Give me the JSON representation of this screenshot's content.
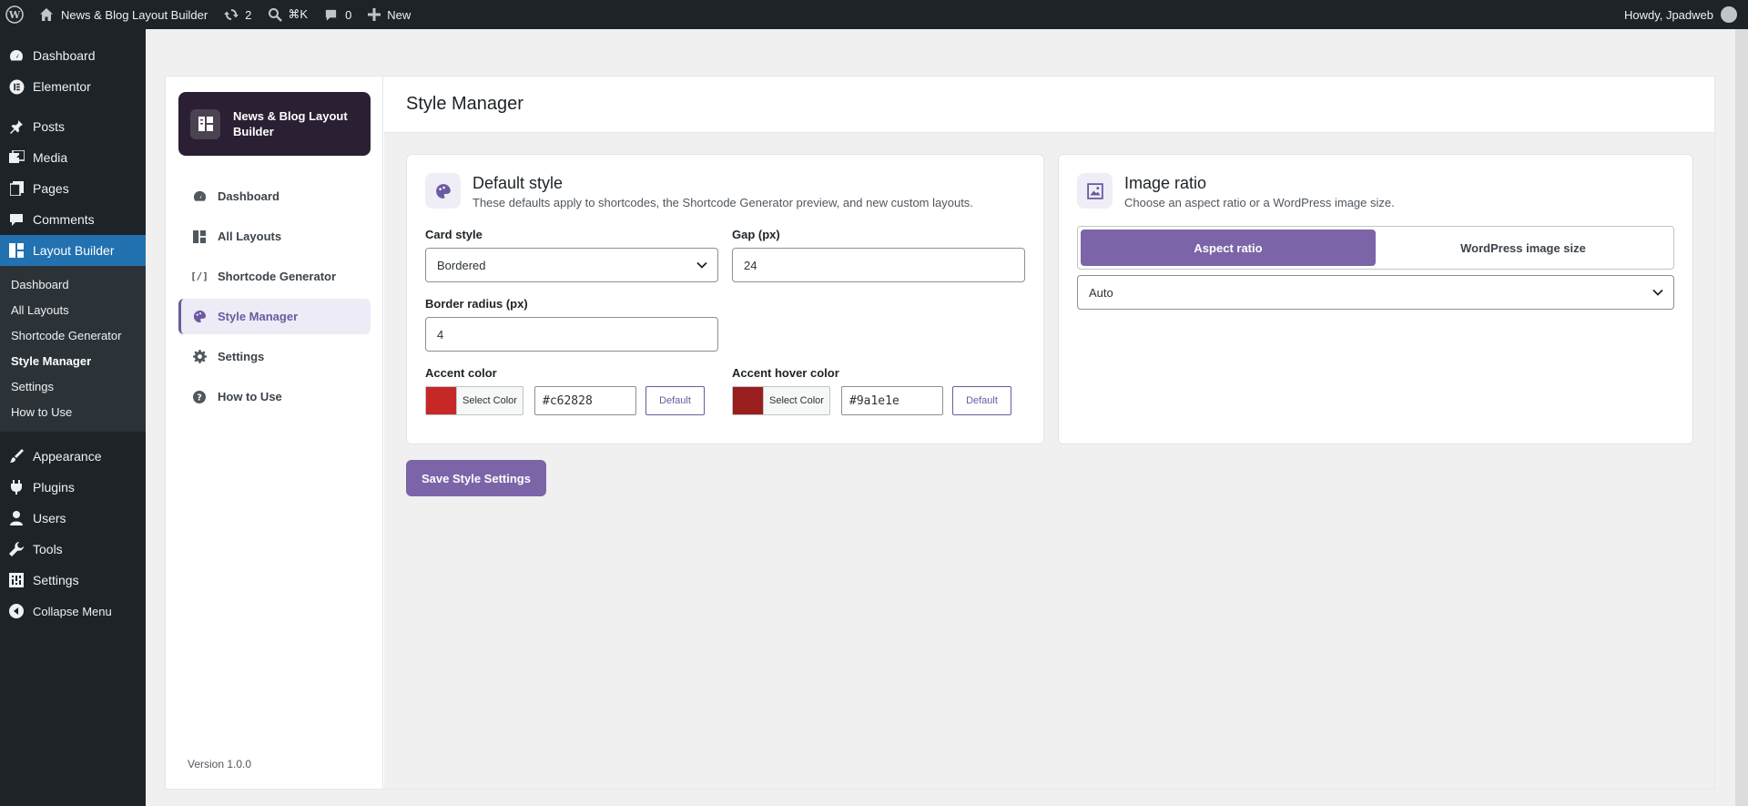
{
  "adminbar": {
    "site_name": "News & Blog Layout Builder",
    "updates_count": "2",
    "search_shortcut": "⌘K",
    "comments_count": "0",
    "new_label": "New",
    "howdy": "Howdy, Jpadweb"
  },
  "adminmenu": {
    "items": [
      {
        "label": "Dashboard",
        "icon": "dashboard-icon"
      },
      {
        "label": "Elementor",
        "icon": "elementor-icon"
      },
      {
        "label": "Posts",
        "icon": "pin-icon"
      },
      {
        "label": "Media",
        "icon": "media-icon"
      },
      {
        "label": "Pages",
        "icon": "pages-icon"
      },
      {
        "label": "Comments",
        "icon": "comment-icon"
      },
      {
        "label": "Layout Builder",
        "icon": "layout-icon"
      },
      {
        "label": "Appearance",
        "icon": "brush-icon"
      },
      {
        "label": "Plugins",
        "icon": "plugin-icon"
      },
      {
        "label": "Users",
        "icon": "user-icon"
      },
      {
        "label": "Tools",
        "icon": "wrench-icon"
      },
      {
        "label": "Settings",
        "icon": "settings-icon"
      },
      {
        "label": "Collapse Menu",
        "icon": "collapse-icon"
      }
    ],
    "submenu": [
      "Dashboard",
      "All Layouts",
      "Shortcode Generator",
      "Style Manager",
      "Settings",
      "How to Use"
    ]
  },
  "plugin": {
    "brand_title": "News & Blog Layout Builder",
    "nav": [
      {
        "label": "Dashboard",
        "icon": "dashboard-icon"
      },
      {
        "label": "All Layouts",
        "icon": "grid-icon"
      },
      {
        "label": "Shortcode Generator",
        "icon": "shortcode-icon"
      },
      {
        "label": "Style Manager",
        "icon": "palette-icon"
      },
      {
        "label": "Settings",
        "icon": "gear-icon"
      },
      {
        "label": "How to Use",
        "icon": "help-icon"
      }
    ],
    "shortcode_glyph": "[/]",
    "version": "Version 1.0.0"
  },
  "main": {
    "page_title": "Style Manager",
    "default_style": {
      "title": "Default style",
      "description": "These defaults apply to shortcodes, the Shortcode Generator preview, and new custom layouts.",
      "card_style_label": "Card style",
      "card_style_value": "Bordered",
      "gap_label": "Gap (px)",
      "gap_value": "24",
      "border_radius_label": "Border radius (px)",
      "border_radius_value": "4",
      "accent_label": "Accent color",
      "accent_value": "#c62828",
      "accent_hover_label": "Accent hover color",
      "accent_hover_value": "#9a1e1e",
      "select_color_label": "Select Color",
      "default_label": "Default"
    },
    "image_ratio": {
      "title": "Image ratio",
      "description": "Choose an aspect ratio or a WordPress image size.",
      "tab_aspect": "Aspect ratio",
      "tab_wp_size": "WordPress image size",
      "ratio_value": "Auto"
    },
    "save_label": "Save Style Settings"
  },
  "colors": {
    "accent": "#c62828",
    "accent_hover": "#9a1e1e",
    "brand_purple": "#7b65a8",
    "wp_blue": "#2271b1"
  }
}
